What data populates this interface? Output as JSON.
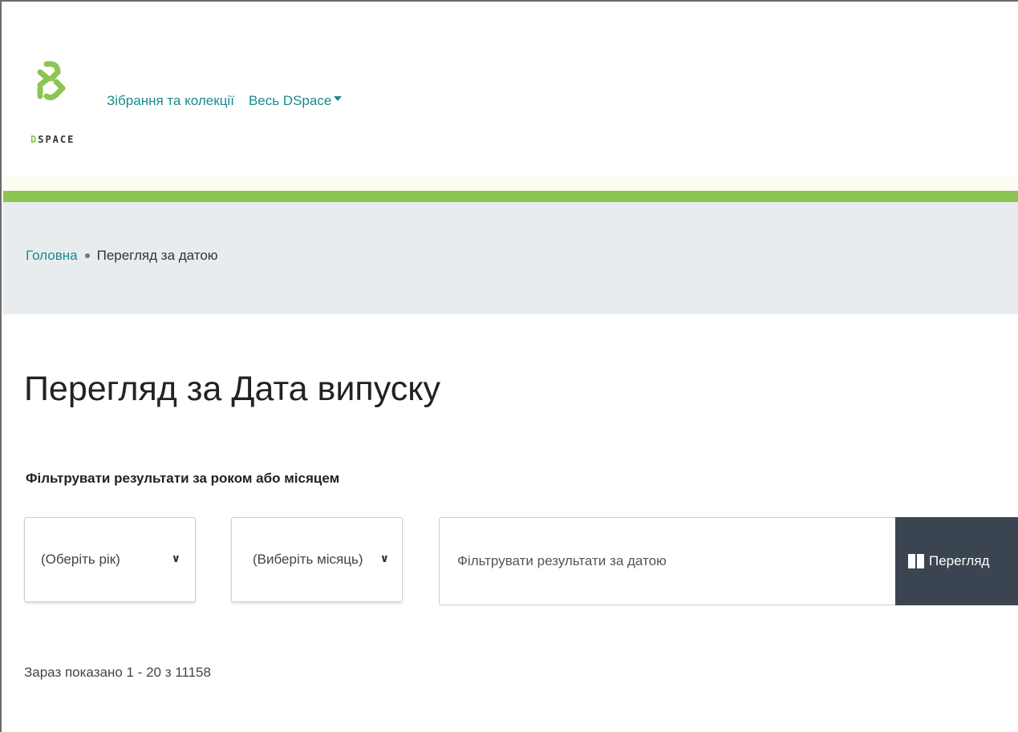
{
  "header": {
    "logo_text_d": "D",
    "logo_text_rest": "SPACE",
    "nav": [
      {
        "label": "Зібрання та колекції"
      },
      {
        "label": "Весь DSpace"
      }
    ]
  },
  "breadcrumb": {
    "home": "Головна",
    "current": "Перегляд за датою"
  },
  "main": {
    "title": "Перегляд за Дата випуску",
    "filter_label": "Фільтрувати результати за роком або місяцем",
    "year_select": {
      "value": "(Оберіть рік)"
    },
    "month_select": {
      "value": "(Виберіть місяць)"
    },
    "date_input": {
      "placeholder": "Фільтрувати результати за датою",
      "value": ""
    },
    "browse_button": "Перегляд",
    "result_count": "Зараз показано 1 - 20 з 11158"
  },
  "colors": {
    "accent_green": "#8dc553",
    "link": "#1b8a8a",
    "button_bg": "#3b4551",
    "breadcrumb_bg": "#e8ecef"
  },
  "icons": {
    "logo": "dspace-logo-icon",
    "caret": "caret-down-icon",
    "chevron": "chevron-down-icon",
    "book": "book-icon"
  }
}
